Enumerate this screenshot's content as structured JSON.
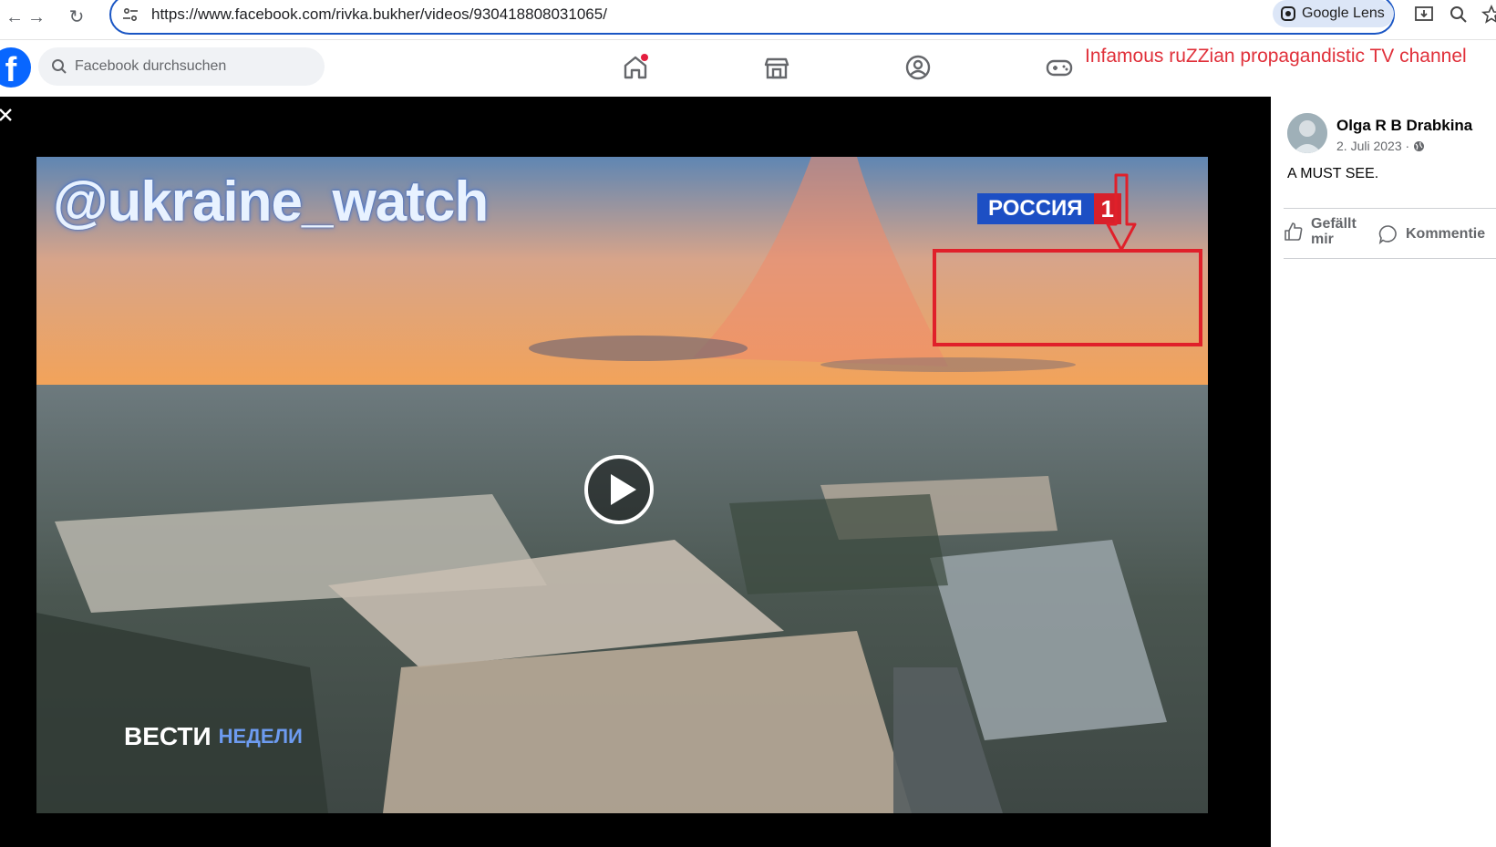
{
  "browser": {
    "url": "https://www.facebook.com/rivka.bukher/videos/930418808031065/",
    "lens_label": "Google Lens",
    "icons": [
      "back-icon",
      "forward-icon",
      "reload-icon",
      "site-settings-icon",
      "install-icon",
      "zoom-icon",
      "bookmark-star-icon"
    ]
  },
  "facebook": {
    "logo": "f",
    "search_placeholder": "Facebook durchsuchen",
    "nav_icons": [
      "home-icon",
      "marketplace-icon",
      "groups-icon",
      "gaming-icon"
    ],
    "home_notification": true
  },
  "annotation": {
    "label": "Infamous ruZZian propagandistic TV channel",
    "color": "#e0202a"
  },
  "video": {
    "watermark": "@ukraine_watch",
    "channel_name": "РОССИЯ",
    "channel_number": "1",
    "news_logo": "ВЕСТИ",
    "news_logo_sub": "НЕДЕЛИ"
  },
  "post": {
    "author": "Olga R B Drabkina",
    "date": "2. Juli 2023 ·",
    "text": "A MUST SEE.",
    "like_label": "Gefällt\nmir",
    "comment_label": "Kommentie"
  }
}
